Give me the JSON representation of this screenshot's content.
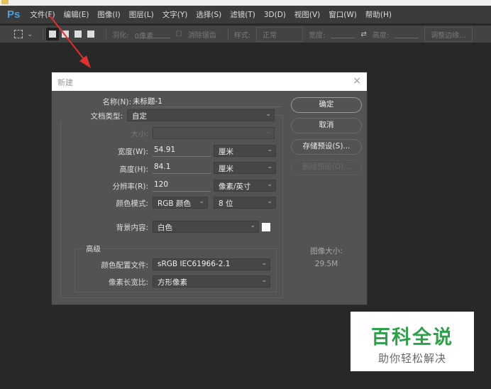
{
  "menubar": {
    "logo": "Ps",
    "items": [
      "文件(F)",
      "编辑(E)",
      "图像(I)",
      "图层(L)",
      "文字(Y)",
      "选择(S)",
      "滤镜(T)",
      "3D(D)",
      "视图(V)",
      "窗口(W)",
      "帮助(H)"
    ]
  },
  "toolbar": {
    "feather_label": "羽化:",
    "feather_value": "0像素",
    "antialias": "消除锯齿",
    "style_label": "样式:",
    "style_value": "正常",
    "width_label": "宽度:",
    "height_label": "高度:",
    "refine": "调整边缘..."
  },
  "dialog": {
    "title": "新建",
    "close": "×",
    "name_label": "名称(N):",
    "name_value": "未标题-1",
    "doctype_label": "文档类型:",
    "doctype_value": "自定",
    "size_label": "大小:",
    "width_label": "宽度(W):",
    "width_value": "54.91",
    "width_unit": "厘米",
    "height_label": "高度(H):",
    "height_value": "84.1",
    "height_unit": "厘米",
    "res_label": "分辨率(R):",
    "res_value": "120",
    "res_unit": "像素/英寸",
    "mode_label": "颜色模式:",
    "mode_value": "RGB 颜色",
    "depth_value": "8 位",
    "bg_label": "背景内容:",
    "bg_value": "白色",
    "bg_color": "#ffffff",
    "advanced": "高级",
    "profile_label": "颜色配置文件:",
    "profile_value": "sRGB IEC61966-2.1",
    "aspect_label": "像素长宽比:",
    "aspect_value": "方形像素",
    "ok": "确定",
    "cancel": "取消",
    "save_preset": "存储预设(S)...",
    "delete_preset": "删除预设(D)...",
    "image_size_label": "图像大小:",
    "image_size_value": "29.5M"
  },
  "watermark": {
    "line1": "百科全说",
    "line2": "助你轻松解决"
  }
}
